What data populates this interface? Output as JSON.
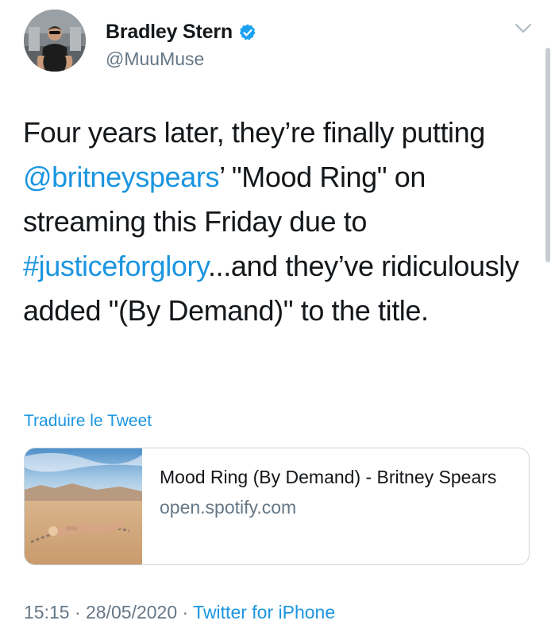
{
  "author": {
    "display_name": "Bradley Stern",
    "handle": "@MuuMuse",
    "verified": true,
    "avatar_icon": "profile-photo"
  },
  "tweet": {
    "text_segments": [
      {
        "text": "Four years later, they’re finally putting ",
        "type": "plain"
      },
      {
        "text": "@britneyspears",
        "type": "mention"
      },
      {
        "text": "’ \"Mood Ring\" on streaming this Friday due to ",
        "type": "plain"
      },
      {
        "text": "#justiceforglory",
        "type": "hashtag"
      },
      {
        "text": "...and they’ve ridiculously added \"(By Demand)\" to the title.",
        "type": "plain"
      }
    ]
  },
  "translate_label": "Traduire le Tweet",
  "card": {
    "title": "Mood Ring (By Demand) - Britney Spears",
    "domain": "open.spotify.com",
    "thumbnail_icon": "album-cover"
  },
  "meta": {
    "time": "15:15",
    "separator": " · ",
    "date": "28/05/2020",
    "source": "Twitter for iPhone"
  },
  "colors": {
    "link": "#1b95e0",
    "text": "#14171a",
    "secondary": "#657786",
    "border": "#ccd6dd"
  }
}
